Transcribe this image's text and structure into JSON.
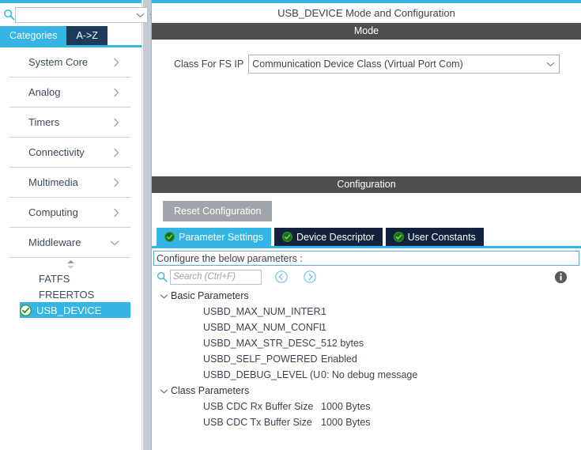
{
  "left": {
    "search": {
      "value": "",
      "placeholder": ""
    },
    "icons": {
      "search": "search-icon",
      "gear": "gear-icon",
      "combo_arrow": "chevron-down-icon"
    },
    "tabs": [
      {
        "label": "Categories",
        "active": true
      },
      {
        "label": "A->Z",
        "active": false
      }
    ],
    "categories": [
      {
        "label": "System Core",
        "expanded": false
      },
      {
        "label": "Analog",
        "expanded": false
      },
      {
        "label": "Timers",
        "expanded": false
      },
      {
        "label": "Connectivity",
        "expanded": false
      },
      {
        "label": "Multimedia",
        "expanded": false
      },
      {
        "label": "Computing",
        "expanded": false
      },
      {
        "label": "Middleware",
        "expanded": true
      }
    ],
    "middleware_items": [
      {
        "label": "FATFS",
        "selected": false,
        "checked": false
      },
      {
        "label": "FREERTOS",
        "selected": false,
        "checked": false
      },
      {
        "label": "USB_DEVICE",
        "selected": true,
        "checked": true
      }
    ]
  },
  "right": {
    "title": "USB_DEVICE Mode and Configuration",
    "mode": {
      "header": "Mode",
      "field_label": "Class For FS IP",
      "field_value": "Communication Device Class (Virtual Port Com)"
    },
    "configuration": {
      "header": "Configuration",
      "reset_label": "Reset Configuration",
      "tabs": [
        {
          "label": "Parameter Settings",
          "active": true
        },
        {
          "label": "Device Descriptor",
          "active": false
        },
        {
          "label": "User Constants",
          "active": false
        }
      ],
      "banner": "Configure the below parameters :",
      "search_placeholder": "Search (Ctrl+F)",
      "search_value": "",
      "groups": [
        {
          "label": "Basic Parameters",
          "expanded": true,
          "rows": [
            {
              "name": "USBD_MAX_NUM_INTERFACE...",
              "value": "1"
            },
            {
              "name": "USBD_MAX_NUM_CONFIGURA...",
              "value": "1"
            },
            {
              "name": "USBD_MAX_STR_DESC_SIZ (M...",
              "value": "512 bytes"
            },
            {
              "name": "USBD_SELF_POWERED (Enab...",
              "value": "Enabled"
            },
            {
              "name": "USBD_DEBUG_LEVEL (USBD ...",
              "value": "0: No debug message"
            }
          ]
        },
        {
          "label": "Class Parameters",
          "expanded": true,
          "rows": [
            {
              "name": "USB CDC Rx Buffer Size",
              "value": "1000 Bytes"
            },
            {
              "name": "USB CDC Tx Buffer Size",
              "value": "1000 Bytes"
            }
          ]
        }
      ]
    }
  },
  "colors": {
    "accent_blue": "#35b5e6",
    "dark_navy": "#12223c",
    "section_gray": "#4f4f4f",
    "button_gray": "#a0a5ab",
    "check_green": "#3aaa35"
  }
}
